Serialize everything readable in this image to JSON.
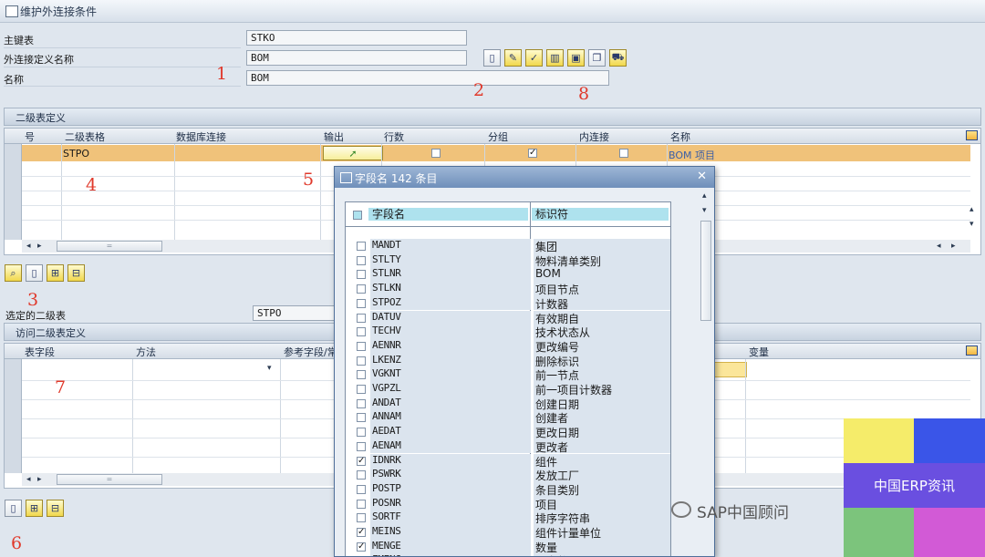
{
  "window": {
    "title": "维护外连接条件"
  },
  "header": {
    "main_table_label": "主键表",
    "main_table_value": "STKO",
    "outer_join_label": "外连接定义名称",
    "outer_join_value": "BOM",
    "name_label": "名称",
    "name_value": "BOM"
  },
  "toolbar_icons": [
    "new-document-icon",
    "edit-pencil-icon",
    "check-icon",
    "delete-trash-icon",
    "save-disk-icon",
    "copy-icon",
    "transport-truck-icon"
  ],
  "annotations": [
    "1",
    "2",
    "8",
    "4",
    "5",
    "3",
    "7",
    "6"
  ],
  "secondary": {
    "section_title": "二级表定义",
    "columns": [
      "号",
      "二级表格",
      "数据库连接",
      "输出",
      "行数",
      "分组",
      "内连接",
      "名称"
    ],
    "rows": [
      {
        "no": "",
        "table": "STPO",
        "db": "",
        "output": "",
        "rows": false,
        "group": true,
        "inner": false,
        "name": "BOM 项目"
      }
    ],
    "button_icons": [
      "detail-magnify-icon",
      "insert-row-icon",
      "add-row-icon",
      "delete-row-icon"
    ]
  },
  "selected_secondary": {
    "label": "选定的二级表",
    "value": "STPO"
  },
  "access": {
    "section_title": "访问二级表定义",
    "columns": [
      "表字段",
      "方法",
      "参考字段/常",
      "变量"
    ],
    "button_icons": [
      "insert-row-icon",
      "add-row-icon",
      "delete-row-icon"
    ]
  },
  "dialog": {
    "title": "字段名 142 条目",
    "col_field": "字段名",
    "col_desc": "标识符",
    "rows": [
      {
        "field": "MANDT",
        "desc": "集团",
        "checked": false
      },
      {
        "field": "STLTY",
        "desc": "物料清单类别",
        "checked": false
      },
      {
        "field": "STLNR",
        "desc": "BOM",
        "checked": false
      },
      {
        "field": "STLKN",
        "desc": "项目节点",
        "checked": false
      },
      {
        "field": "STPOZ",
        "desc": "计数器",
        "checked": false
      },
      {
        "field": "DATUV",
        "desc": "有效期自",
        "checked": false
      },
      {
        "field": "TECHV",
        "desc": "技术状态从",
        "checked": false
      },
      {
        "field": "AENNR",
        "desc": "更改编号",
        "checked": false
      },
      {
        "field": "LKENZ",
        "desc": "删除标识",
        "checked": false
      },
      {
        "field": "VGKNT",
        "desc": "前一节点",
        "checked": false
      },
      {
        "field": "VGPZL",
        "desc": "前一项目计数器",
        "checked": false
      },
      {
        "field": "ANDAT",
        "desc": "创建日期",
        "checked": false
      },
      {
        "field": "ANNAM",
        "desc": "创建者",
        "checked": false
      },
      {
        "field": "AEDAT",
        "desc": "更改日期",
        "checked": false
      },
      {
        "field": "AENAM",
        "desc": "更改者",
        "checked": false
      },
      {
        "field": "IDNRK",
        "desc": "组件",
        "checked": true
      },
      {
        "field": "PSWRK",
        "desc": "发放工厂",
        "checked": false
      },
      {
        "field": "POSTP",
        "desc": "条目类别",
        "checked": false
      },
      {
        "field": "POSNR",
        "desc": "项目",
        "checked": false
      },
      {
        "field": "SORTF",
        "desc": "排序字符串",
        "checked": false
      },
      {
        "field": "MEINS",
        "desc": "组件计量单位",
        "checked": true
      },
      {
        "field": "MENGE",
        "desc": "数量",
        "checked": true
      },
      {
        "field": "FMENG",
        "desc": "固定数量",
        "checked": false
      }
    ]
  },
  "watermark": {
    "text": "SAP中国顾问"
  },
  "brand": {
    "text": "中国ERP资讯",
    "colors": [
      "#f5ec6a",
      "#3a55e8",
      "#6a4fe0",
      "#7cc47c",
      "#d25ad6"
    ]
  }
}
